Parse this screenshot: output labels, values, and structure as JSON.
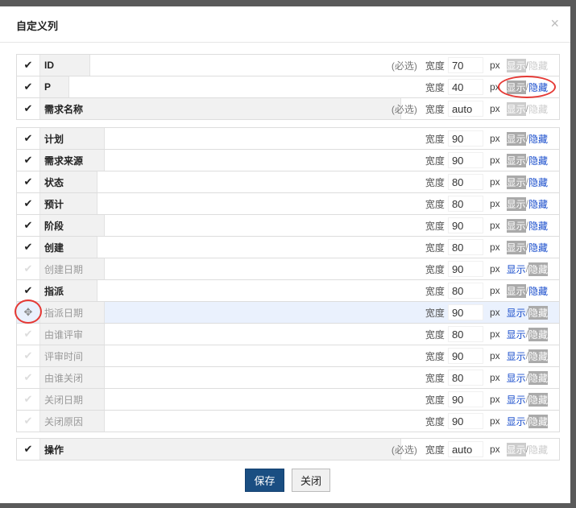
{
  "dialog": {
    "title": "自定义列",
    "close_icon": "×",
    "save_label": "保存",
    "close_label": "关闭"
  },
  "common": {
    "required": "(必选)",
    "width_label": "宽度",
    "unit": "px",
    "show": "显示",
    "hide": "隐藏",
    "sep": "/",
    "check": "✔",
    "move": "✥"
  },
  "groups": [
    [
      {
        "name": "ID",
        "width": "70",
        "visible": true,
        "required": true,
        "lw": 62
      },
      {
        "name": "P",
        "width": "40",
        "visible": true,
        "required": false,
        "lw": 36
      },
      {
        "name": "需求名称",
        "width": "auto",
        "visible": true,
        "required": true,
        "lw": 448
      }
    ],
    [
      {
        "name": "计划",
        "width": "90",
        "visible": true,
        "lw": 80
      },
      {
        "name": "需求来源",
        "width": "90",
        "visible": true,
        "lw": 80
      },
      {
        "name": "状态",
        "width": "80",
        "visible": true,
        "lw": 71
      },
      {
        "name": "预计",
        "width": "80",
        "visible": true,
        "lw": 71
      },
      {
        "name": "阶段",
        "width": "90",
        "visible": true,
        "lw": 80
      },
      {
        "name": "创建",
        "width": "80",
        "visible": true,
        "lw": 71
      },
      {
        "name": "创建日期",
        "width": "90",
        "visible": false,
        "lw": 80
      },
      {
        "name": "指派",
        "width": "80",
        "visible": true,
        "lw": 71
      },
      {
        "name": "指派日期",
        "width": "90",
        "visible": false,
        "lw": 80,
        "dragging": true
      },
      {
        "name": "由谁评审",
        "width": "80",
        "visible": false,
        "lw": 80
      },
      {
        "name": "评审时间",
        "width": "90",
        "visible": false,
        "lw": 80
      },
      {
        "name": "由谁关闭",
        "width": "80",
        "visible": false,
        "lw": 80
      },
      {
        "name": "关闭日期",
        "width": "90",
        "visible": false,
        "lw": 80
      },
      {
        "name": "关闭原因",
        "width": "90",
        "visible": false,
        "lw": 80
      }
    ],
    [
      {
        "name": "操作",
        "width": "auto",
        "visible": true,
        "required": true,
        "lw": 448
      }
    ]
  ]
}
